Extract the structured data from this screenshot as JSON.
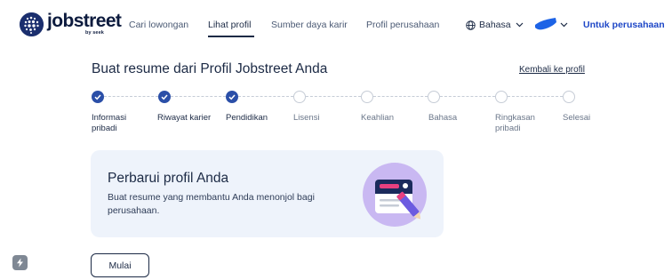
{
  "header": {
    "logo": {
      "word": "jobstreet",
      "sub": "by seek"
    },
    "nav": [
      {
        "label": "Cari lowongan",
        "active": false
      },
      {
        "label": "Lihat profil",
        "active": true
      },
      {
        "label": "Sumber daya karir",
        "active": false
      },
      {
        "label": "Profil perusahaan",
        "active": false
      }
    ],
    "language_label": "Bahasa",
    "employer_link": "Untuk perusahaan"
  },
  "page": {
    "title": "Buat resume dari Profil Jobstreet Anda",
    "back_link": "Kembali ke profil"
  },
  "stepper": {
    "steps": [
      {
        "line1": "Informasi",
        "line2": "pribadi",
        "state": "done"
      },
      {
        "line1": "Riwayat karier",
        "line2": "",
        "state": "done"
      },
      {
        "line1": "Pendidikan",
        "line2": "",
        "state": "done"
      },
      {
        "line1": "Lisensi",
        "line2": "",
        "state": "todo"
      },
      {
        "line1": "Keahlian",
        "line2": "",
        "state": "todo"
      },
      {
        "line1": "Bahasa",
        "line2": "",
        "state": "todo"
      },
      {
        "line1": "Ringkasan",
        "line2": "pribadi",
        "state": "todo"
      },
      {
        "line1": "Selesai",
        "line2": "",
        "state": "todo"
      }
    ]
  },
  "card": {
    "title": "Perbarui profil Anda",
    "body": "Buat resume yang membantu Anda menonjol bagi perusahaan."
  },
  "actions": {
    "start_label": "Mulai"
  },
  "colors": {
    "brand_navy": "#1b2f6e",
    "step_done": "#2b4fa8",
    "employer_link": "#1e47c7",
    "card_bg": "#eef3fb",
    "illustration_purple": "#c9b8f2"
  },
  "icons": {
    "logo": "jobstreet-globe-icon",
    "language": "globe-icon",
    "check": "check-icon",
    "illustration": "resume-edit-icon"
  }
}
